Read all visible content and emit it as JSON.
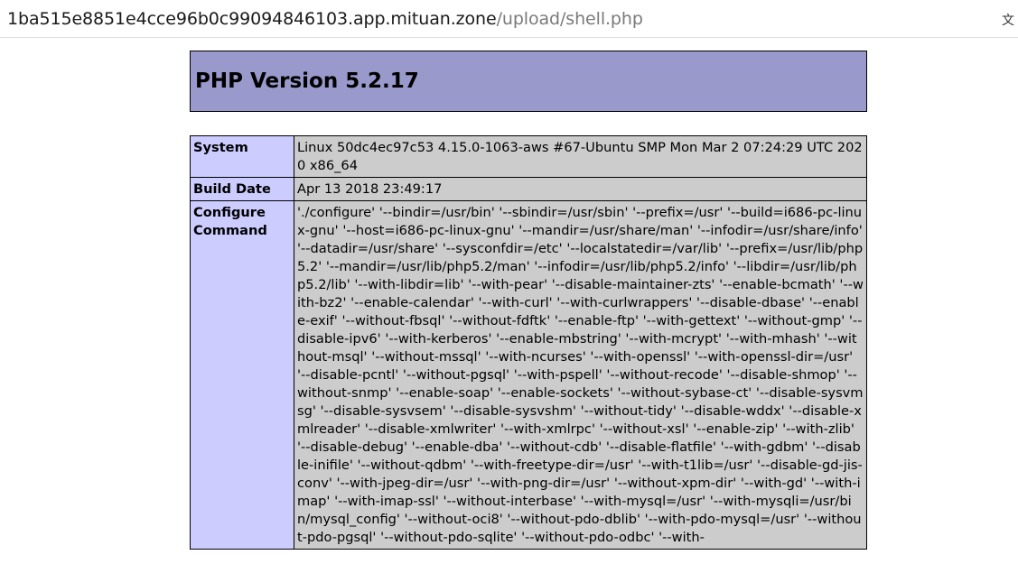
{
  "browser": {
    "url_host": "1ba515e8851e4cce96b0c99094846103.app.mituan.zone",
    "url_path": "/upload/shell.php",
    "translate_icon": "translate-icon"
  },
  "page": {
    "title": "PHP Version 5.2.17",
    "rows": [
      {
        "label": "System",
        "value": "Linux 50dc4ec97c53 4.15.0-1063-aws #67-Ubuntu SMP Mon Mar 2 07:24:29 UTC 2020 x86_64"
      },
      {
        "label": "Build Date",
        "value": "Apr 13 2018 23:49:17"
      },
      {
        "label": "Configure Command",
        "value": "'./configure' '--bindir=/usr/bin' '--sbindir=/usr/sbin' '--prefix=/usr' '--build=i686-pc-linux-gnu' '--host=i686-pc-linux-gnu' '--mandir=/usr/share/man' '--infodir=/usr/share/info' '--datadir=/usr/share' '--sysconfdir=/etc' '--localstatedir=/var/lib' '--prefix=/usr/lib/php5.2' '--mandir=/usr/lib/php5.2/man' '--infodir=/usr/lib/php5.2/info' '--libdir=/usr/lib/php5.2/lib' '--with-libdir=lib' '--with-pear' '--disable-maintainer-zts' '--enable-bcmath' '--with-bz2' '--enable-calendar' '--with-curl' '--with-curlwrappers' '--disable-dbase' '--enable-exif' '--without-fbsql' '--without-fdftk' '--enable-ftp' '--with-gettext' '--without-gmp' '--disable-ipv6' '--with-kerberos' '--enable-mbstring' '--with-mcrypt' '--with-mhash' '--without-msql' '--without-mssql' '--with-ncurses' '--with-openssl' '--with-openssl-dir=/usr' '--disable-pcntl' '--without-pgsql' '--with-pspell' '--without-recode' '--disable-shmop' '--without-snmp' '--enable-soap' '--enable-sockets' '--without-sybase-ct' '--disable-sysvmsg' '--disable-sysvsem' '--disable-sysvshm' '--without-tidy' '--disable-wddx' '--disable-xmlreader' '--disable-xmlwriter' '--with-xmlrpc' '--without-xsl' '--enable-zip' '--with-zlib' '--disable-debug' '--enable-dba' '--without-cdb' '--disable-flatfile' '--with-gdbm' '--disable-inifile' '--without-qdbm' '--with-freetype-dir=/usr' '--with-t1lib=/usr' '--disable-gd-jis-conv' '--with-jpeg-dir=/usr' '--with-png-dir=/usr' '--without-xpm-dir' '--with-gd' '--with-imap' '--with-imap-ssl' '--without-interbase' '--with-mysql=/usr' '--with-mysqli=/usr/bin/mysql_config' '--without-oci8' '--without-pdo-dblib' '--with-pdo-mysql=/usr' '--without-pdo-pgsql' '--without-pdo-sqlite' '--without-pdo-odbc' '--with-"
      }
    ]
  },
  "colors": {
    "header_bg": "#9999cc",
    "label_bg": "#ccccff",
    "value_bg": "#cccccc"
  }
}
